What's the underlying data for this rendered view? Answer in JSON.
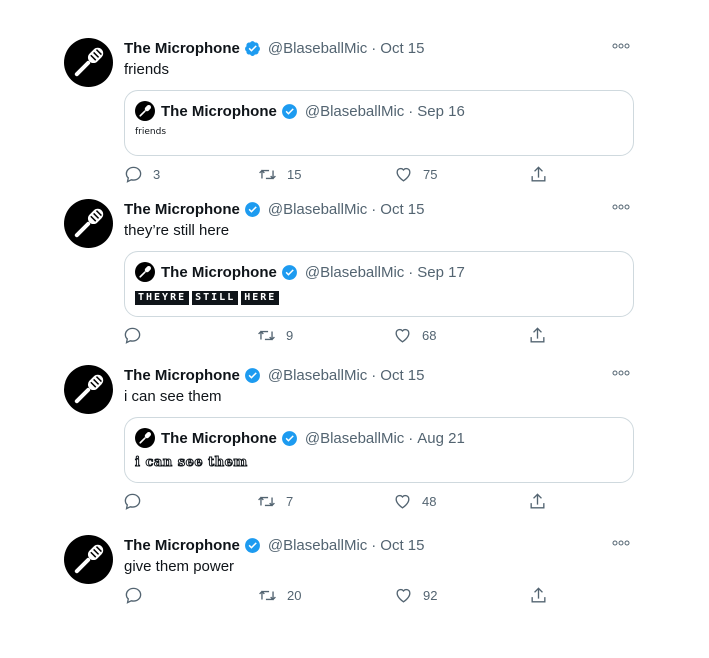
{
  "author": {
    "name": "The Microphone",
    "handle": "@BlaseballMic",
    "avatar_icon": "microphone-icon"
  },
  "colors": {
    "verified": "#1d9bf0",
    "muted": "#536471",
    "border": "#cfd9de"
  },
  "tweets": [
    {
      "date": "Oct 15",
      "text": "friends",
      "quote": {
        "date": "Sep 16",
        "text": "friends",
        "style": "small"
      },
      "replies": "3",
      "retweets": "15",
      "likes": "75"
    },
    {
      "date": "Oct 15",
      "text": "they’re still here",
      "quote": {
        "date": "Sep 17",
        "words": [
          "THEYRE",
          "STILL",
          "HERE"
        ],
        "style": "blocks"
      },
      "replies": "",
      "retweets": "9",
      "likes": "68"
    },
    {
      "date": "Oct 15",
      "text": "i can see them",
      "quote": {
        "date": "Aug 21",
        "text": "i can see them",
        "style": "outline"
      },
      "replies": "",
      "retweets": "7",
      "likes": "48"
    },
    {
      "date": "Oct 15",
      "text": "give them power",
      "replies": "",
      "retweets": "20",
      "likes": "92"
    }
  ],
  "separator": "·"
}
